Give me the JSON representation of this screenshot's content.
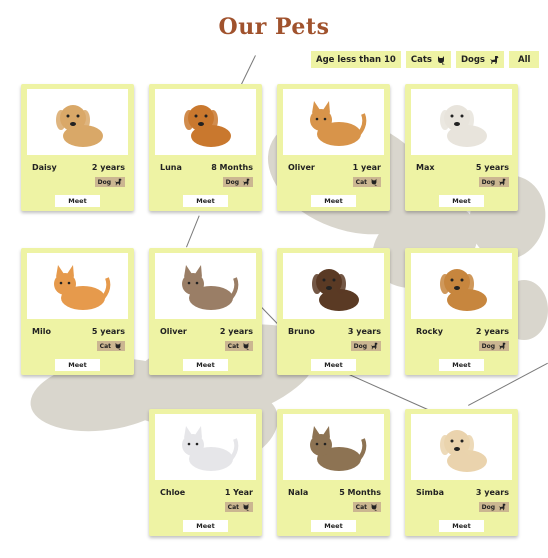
{
  "title": "Our Pets",
  "filters": [
    {
      "label": "Age less than 10",
      "icon": ""
    },
    {
      "label": "Cats",
      "icon": "cat-icon"
    },
    {
      "label": "Dogs",
      "icon": "dog-icon"
    },
    {
      "label": "All",
      "icon": ""
    }
  ],
  "meet_label": "Meet",
  "pets": [
    {
      "name": "Daisy",
      "age": "2 years",
      "type": "Dog",
      "icon": "dog-icon",
      "coat": "#d9a868"
    },
    {
      "name": "Luna",
      "age": "8 Months",
      "type": "Dog",
      "icon": "dog-icon",
      "coat": "#c9782e"
    },
    {
      "name": "Oliver",
      "age": "1 year",
      "type": "Cat",
      "icon": "cat-icon",
      "coat": "#d8944a"
    },
    {
      "name": "Max",
      "age": "5 years",
      "type": "Dog",
      "icon": "dog-icon",
      "coat": "#e8e4dc"
    },
    {
      "name": "Milo",
      "age": "5 years",
      "type": "Cat",
      "icon": "cat-icon",
      "coat": "#e69a4c"
    },
    {
      "name": "Oliver",
      "age": "2 years",
      "type": "Cat",
      "icon": "cat-icon",
      "coat": "#9a7e66"
    },
    {
      "name": "Bruno",
      "age": "3 years",
      "type": "Dog",
      "icon": "dog-icon",
      "coat": "#5a3a24"
    },
    {
      "name": "Rocky",
      "age": "2 years",
      "type": "Dog",
      "icon": "dog-icon",
      "coat": "#c7863e"
    },
    {
      "name": "Chloe",
      "age": "1 Year",
      "type": "Cat",
      "icon": "cat-icon",
      "coat": "#e6e6e9"
    },
    {
      "name": "Nala",
      "age": "5 Months",
      "type": "Cat",
      "icon": "cat-icon",
      "coat": "#8d7353"
    },
    {
      "name": "Simba",
      "age": "3 years",
      "type": "Dog",
      "icon": "dog-icon",
      "coat": "#ead3ad"
    }
  ],
  "colors": {
    "card": "#eef3a4",
    "badge": "#cbb691",
    "title": "#a0522d",
    "paw": "#d9d6cd"
  }
}
